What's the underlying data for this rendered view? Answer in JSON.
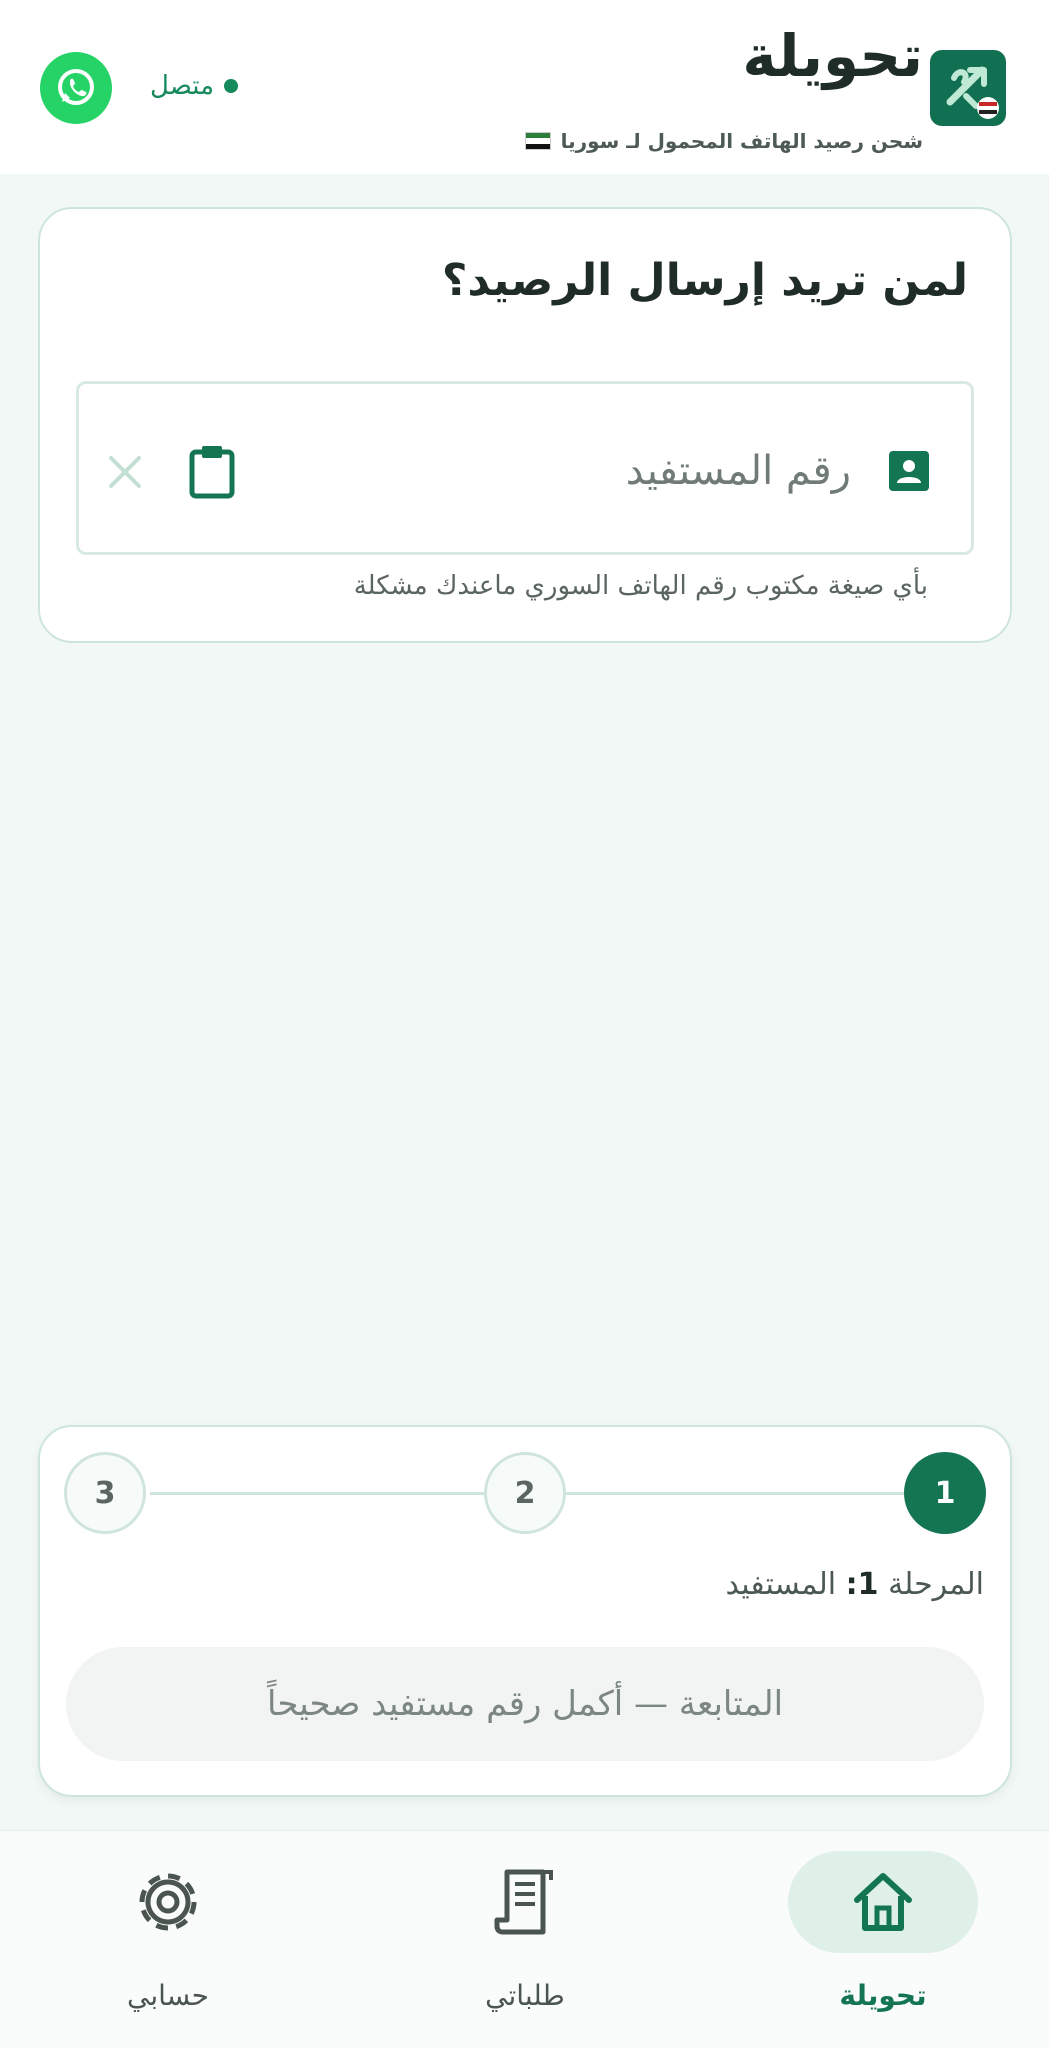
{
  "header": {
    "title": "تحويلة",
    "subtitle": "شحن رصيد الهاتف المحمول لـ سوريا",
    "status": "متصل"
  },
  "recipient": {
    "heading": "لمن تريد إرسال الرصيد؟",
    "input_placeholder": "رقم المستفيد",
    "input_value": "",
    "hint": "بأي صيغة مكتوب رقم الهاتف السوري ماعندك مشكلة"
  },
  "stepper": {
    "steps": [
      "1",
      "2",
      "3"
    ],
    "current_step": 1,
    "stage_prefix": "المرحلة",
    "stage_number": "1:",
    "stage_name": "المستفيد",
    "continue_label": "المتابعة — أكمل رقم مستفيد صحيحاً"
  },
  "nav": {
    "items": [
      {
        "label": "تحويلة",
        "icon": "home-icon",
        "active": true
      },
      {
        "label": "طلباتي",
        "icon": "receipt-icon",
        "active": false
      },
      {
        "label": "حسابي",
        "icon": "gear-icon",
        "active": false
      }
    ]
  },
  "colors": {
    "brand": "#147552",
    "whatsapp": "#25d366",
    "background": "#f2f8f6",
    "card_border": "#cde5dc"
  }
}
